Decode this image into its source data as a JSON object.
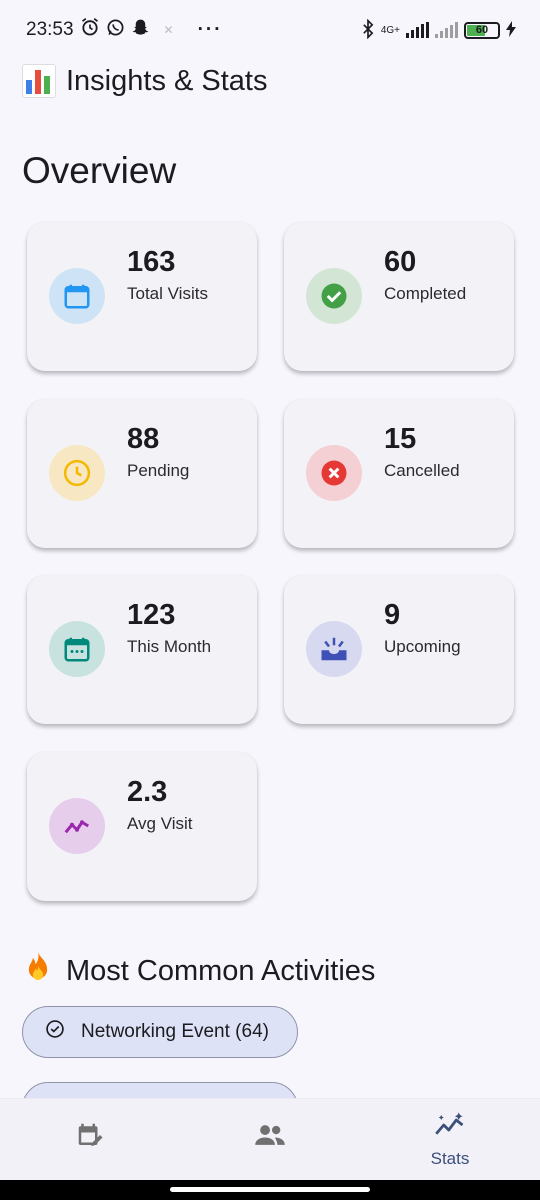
{
  "status_bar": {
    "time": "23:53",
    "network": "4G+",
    "battery": "60"
  },
  "header": {
    "title": "Insights & Stats"
  },
  "overview": {
    "title": "Overview",
    "cards": [
      {
        "value": "163",
        "label": "Total Visits",
        "icon": "calendar-icon",
        "color": "#2196f3",
        "bg": "#cfe3f6"
      },
      {
        "value": "60",
        "label": "Completed",
        "icon": "check-circle-icon",
        "color": "#43a047",
        "bg": "#d3e6d6"
      },
      {
        "value": "88",
        "label": "Pending",
        "icon": "clock-icon",
        "color": "#f5b800",
        "bg": "#f7e8c3"
      },
      {
        "value": "15",
        "label": "Cancelled",
        "icon": "cancel-icon",
        "color": "#e53935",
        "bg": "#f4cfd3"
      },
      {
        "value": "123",
        "label": "This Month",
        "icon": "calendar-month-icon",
        "color": "#00897b",
        "bg": "#c8e2e0"
      },
      {
        "value": "9",
        "label": "Upcoming",
        "icon": "upcoming-icon",
        "color": "#3f51b5",
        "bg": "#d6d9ef"
      },
      {
        "value": "2.3",
        "label": "Avg Visit",
        "icon": "trending-icon",
        "color": "#9c27b0",
        "bg": "#e6cdeb"
      }
    ]
  },
  "activities": {
    "title": "Most Common Activities",
    "items": [
      {
        "label": "Networking Event (64)"
      }
    ]
  },
  "bottom_nav": {
    "items": [
      {
        "label": "",
        "icon": "calendar-edit-icon"
      },
      {
        "label": "",
        "icon": "people-icon"
      },
      {
        "label": "Stats",
        "icon": "auto-graph-icon"
      }
    ]
  }
}
